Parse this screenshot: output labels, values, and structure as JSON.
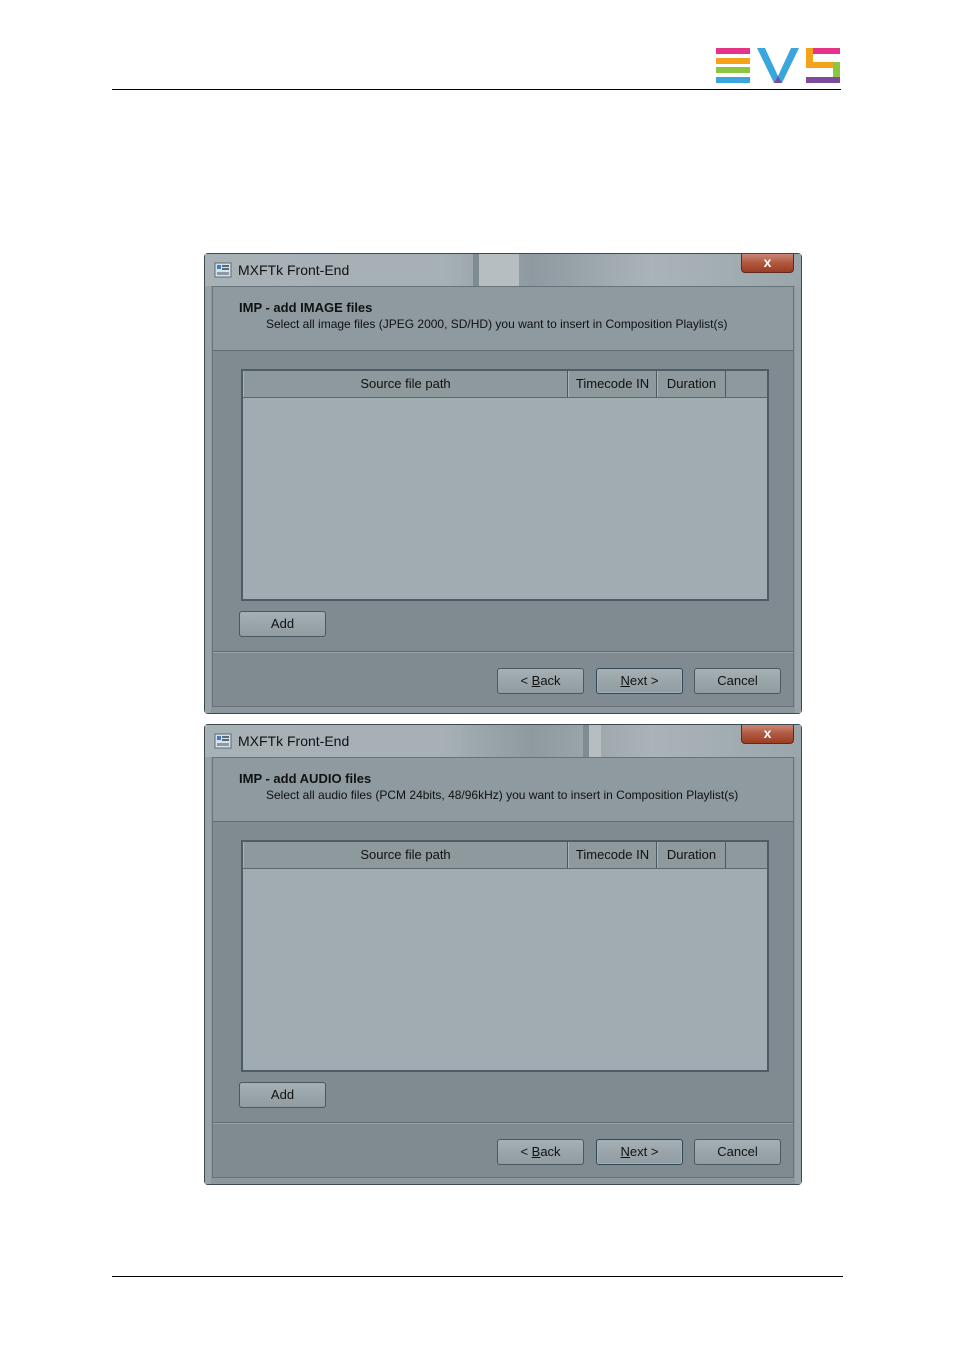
{
  "brand": {
    "logo_text": "EVS",
    "colors": [
      "#3aa6dd",
      "#f5a21b",
      "#8cc63f",
      "#e6338a",
      "#7f4b9e"
    ]
  },
  "windows": [
    {
      "title": "MXFTk Front-End",
      "close_label": "x",
      "header_title": "IMP - add IMAGE files",
      "header_subtitle": "Select all image files (JPEG 2000, SD/HD) you want to insert in Composition Playlist(s)",
      "columns": [
        "Source file path",
        "Timecode IN",
        "Duration"
      ],
      "add_label": "Add",
      "back_prefix": "< ",
      "back_accel": "B",
      "back_rest": "ack",
      "next_accel": "N",
      "next_rest": "ext >",
      "cancel_label": "Cancel"
    },
    {
      "title": "MXFTk Front-End",
      "close_label": "x",
      "header_title": "IMP - add AUDIO files",
      "header_subtitle": "Select all audio files (PCM 24bits, 48/96kHz) you want to insert in Composition Playlist(s)",
      "columns": [
        "Source file path",
        "Timecode IN",
        "Duration"
      ],
      "add_label": "Add",
      "back_prefix": "< ",
      "back_accel": "B",
      "back_rest": "ack",
      "next_accel": "N",
      "next_rest": "ext >",
      "cancel_label": "Cancel"
    }
  ]
}
